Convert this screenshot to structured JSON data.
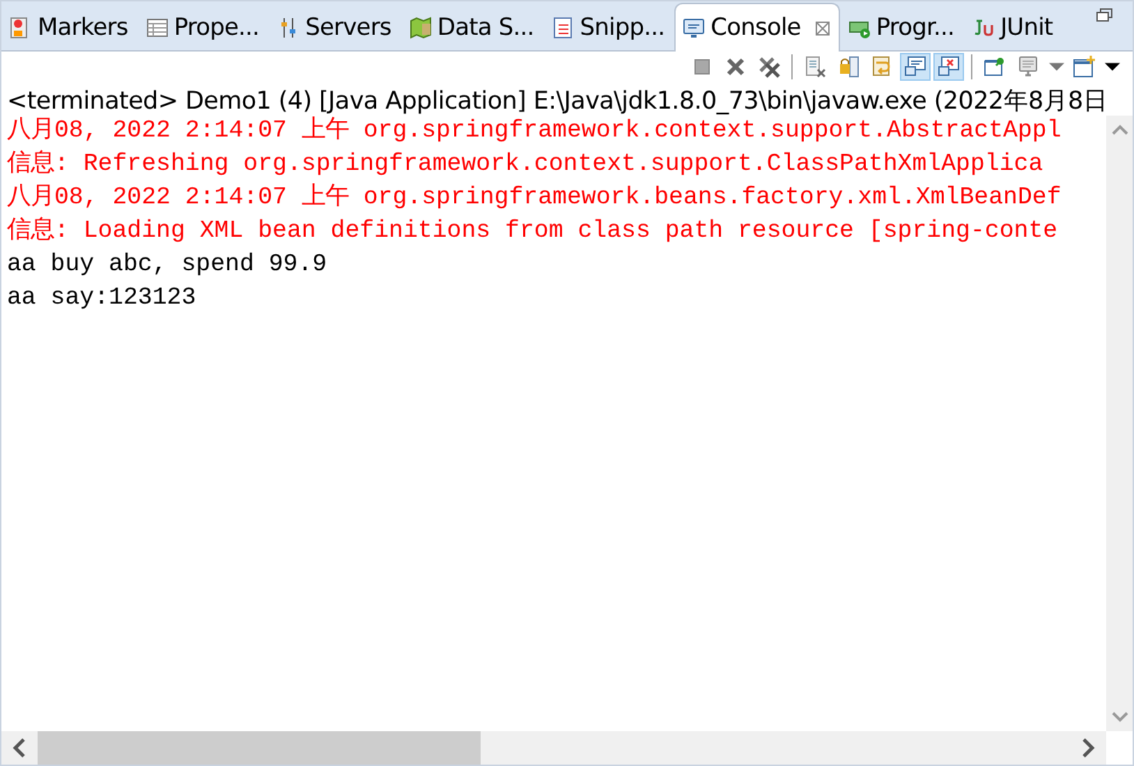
{
  "tabs": [
    {
      "label": "Markers",
      "selected": false
    },
    {
      "label": "Prope...",
      "selected": false
    },
    {
      "label": "Servers",
      "selected": false
    },
    {
      "label": "Data S...",
      "selected": false
    },
    {
      "label": "Snipp...",
      "selected": false
    },
    {
      "label": "Console",
      "selected": true
    },
    {
      "label": "Progr...",
      "selected": false
    },
    {
      "label": "JUnit",
      "selected": false
    }
  ],
  "toolbar": [
    {
      "kind": "terminate",
      "selected": false
    },
    {
      "kind": "remove",
      "selected": false
    },
    {
      "kind": "remove-all",
      "selected": false
    },
    {
      "kind": "sep"
    },
    {
      "kind": "clear",
      "selected": false
    },
    {
      "kind": "scroll-lock",
      "selected": false
    },
    {
      "kind": "word-wrap",
      "selected": false
    },
    {
      "kind": "show-out",
      "selected": true
    },
    {
      "kind": "show-err",
      "selected": true
    },
    {
      "kind": "sep"
    },
    {
      "kind": "pin",
      "selected": false
    },
    {
      "kind": "display",
      "selected": false
    },
    {
      "kind": "dropdown",
      "selected": false
    },
    {
      "kind": "new-console",
      "selected": false
    },
    {
      "kind": "menu",
      "selected": false
    }
  ],
  "console": {
    "header": "<terminated> Demo1 (4) [Java Application] E:\\Java\\jdk1.8.0_73\\bin\\javaw.exe (2022年8月8日",
    "lines": [
      {
        "kind": "stderr",
        "text": "八月08, 2022 2:14:07 上午 org.springframework.context.support.AbstractAppl"
      },
      {
        "kind": "stderr",
        "text": "信息: Refreshing org.springframework.context.support.ClassPathXmlApplica"
      },
      {
        "kind": "stderr",
        "text": "八月08, 2022 2:14:07 上午 org.springframework.beans.factory.xml.XmlBeanDef"
      },
      {
        "kind": "stderr",
        "text": "信息: Loading XML bean definitions from class path resource [spring-conte"
      },
      {
        "kind": "stdout",
        "text": "aa buy abc, spend 99.9"
      },
      {
        "kind": "stdout",
        "text": "aa say:123123"
      }
    ]
  }
}
